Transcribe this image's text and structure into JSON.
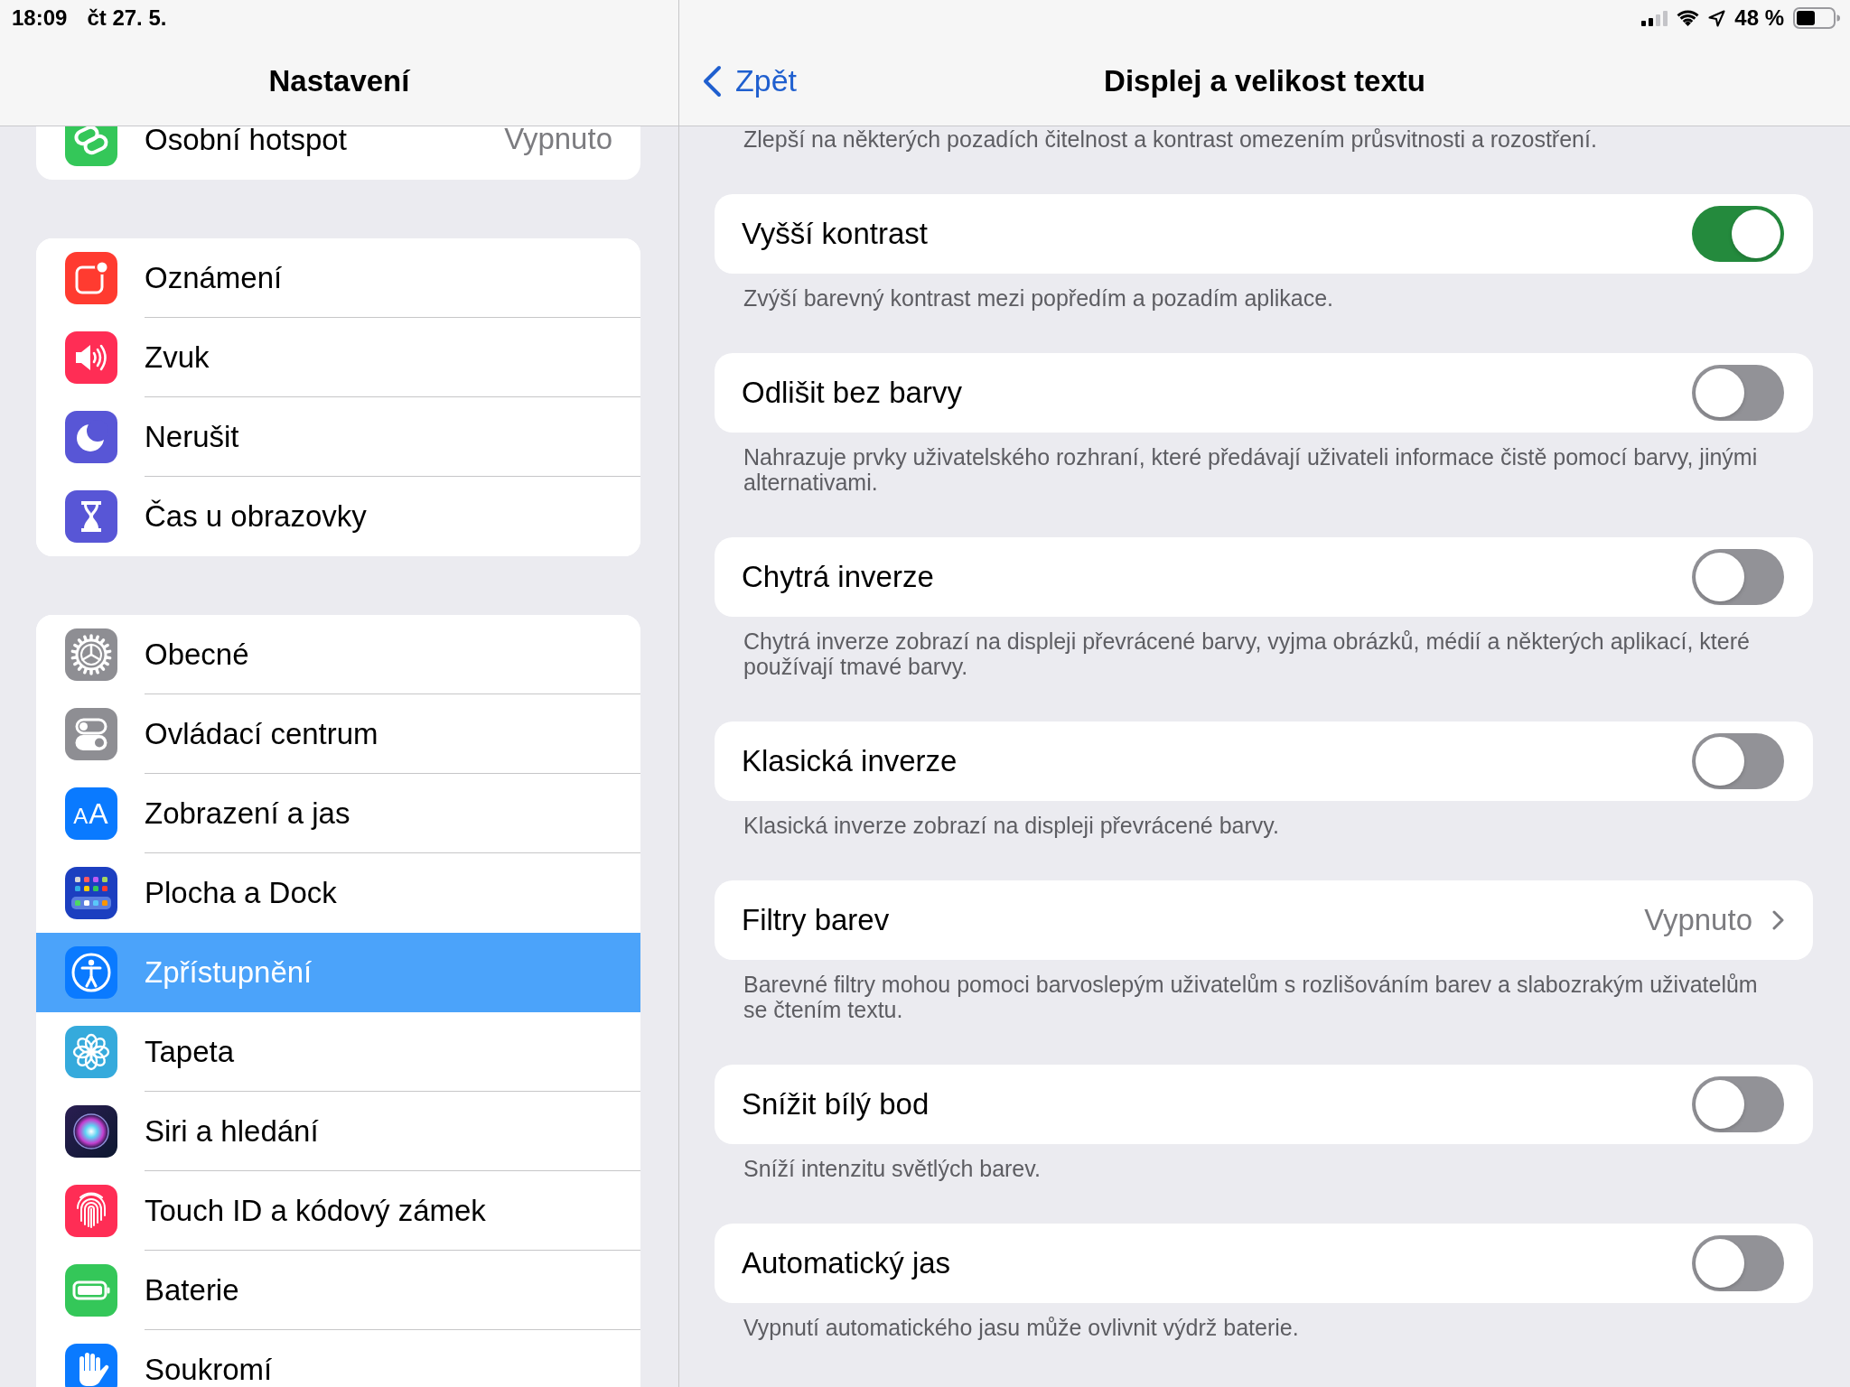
{
  "status_bar": {
    "time": "18:09",
    "date": "čt 27. 5.",
    "battery": "48 %"
  },
  "sidebar": {
    "title": "Nastavení",
    "groups": [
      {
        "items": [
          {
            "label": "Osobní hotspot",
            "value": "Vypnuto",
            "selected": false
          }
        ]
      },
      {
        "items": [
          {
            "label": "Oznámení",
            "selected": false
          },
          {
            "label": "Zvuk",
            "selected": false
          },
          {
            "label": "Nerušit",
            "selected": false
          },
          {
            "label": "Čas u obrazovky",
            "selected": false
          }
        ]
      },
      {
        "items": [
          {
            "label": "Obecné",
            "selected": false
          },
          {
            "label": "Ovládací centrum",
            "selected": false
          },
          {
            "label": "Zobrazení a jas",
            "icon_text": "AA",
            "selected": false
          },
          {
            "label": "Plocha a Dock",
            "selected": false
          },
          {
            "label": "Zpřístupnění",
            "selected": true
          },
          {
            "label": "Tapeta",
            "selected": false
          },
          {
            "label": "Siri a hledání",
            "selected": false
          },
          {
            "label": "Touch ID a kódový zámek",
            "selected": false
          },
          {
            "label": "Baterie",
            "selected": false
          },
          {
            "label": "Soukromí",
            "selected": false
          }
        ]
      }
    ]
  },
  "detail": {
    "back": "Zpět",
    "title": "Displej a velikost textu",
    "sections": [
      {
        "footer": "Zlepší na některých pozadích čitelnost a kontrast omezením průsvitnosti a rozostření."
      },
      {
        "row": {
          "kind": "toggle",
          "label": "Vyšší kontrast",
          "on": true
        },
        "footer": "Zvýší barevný kontrast mezi popředím a pozadím aplikace."
      },
      {
        "row": {
          "kind": "toggle",
          "label": "Odlišit bez barvy",
          "on": false
        },
        "footer": "Nahrazuje prvky uživatelského rozhraní, které předávají uživateli informace čistě pomocí barvy, jinými alternativami."
      },
      {
        "row": {
          "kind": "toggle",
          "label": "Chytrá inverze",
          "on": false
        },
        "footer": "Chytrá inverze zobrazí na displeji převrácené barvy, vyjma obrázků, médií a některých aplikací, které používají tmavé barvy."
      },
      {
        "row": {
          "kind": "toggle",
          "label": "Klasická inverze",
          "on": false
        },
        "footer": "Klasická inverze zobrazí na displeji převrácené barvy."
      },
      {
        "row": {
          "kind": "link",
          "label": "Filtry barev",
          "value": "Vypnuto"
        },
        "footer": "Barevné filtry mohou pomoci barvoslepým uživatelům s rozlišováním barev a slabozrakým uživatelům se čtením textu."
      },
      {
        "row": {
          "kind": "toggle",
          "label": "Snížit bílý bod",
          "on": false
        },
        "footer": "Sníží intenzitu světlých barev."
      },
      {
        "row": {
          "kind": "toggle",
          "label": "Automatický jas",
          "on": false
        },
        "footer": "Vypnutí automatického jasu může ovlivnit výdrž baterie."
      }
    ]
  }
}
